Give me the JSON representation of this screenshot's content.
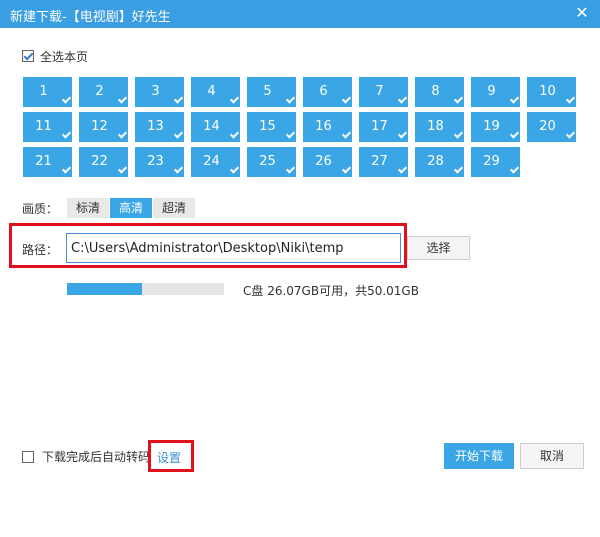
{
  "window": {
    "title": "新建下载-【电视剧】好先生",
    "close_label": "✕"
  },
  "select_all": {
    "label": "全选本页",
    "checked": true
  },
  "episodes": [
    "1",
    "2",
    "3",
    "4",
    "5",
    "6",
    "7",
    "8",
    "9",
    "10",
    "11",
    "12",
    "13",
    "14",
    "15",
    "16",
    "17",
    "18",
    "19",
    "20",
    "21",
    "22",
    "23",
    "24",
    "25",
    "26",
    "27",
    "28",
    "29"
  ],
  "quality": {
    "label": "画质：",
    "options": [
      "标清",
      "高清",
      "超清"
    ],
    "selected": "高清"
  },
  "path": {
    "label": "路径：",
    "value": "C:\\Users\\Administrator\\Desktop\\Niki\\temp",
    "choose_label": "选择"
  },
  "disk": {
    "info": "C盘 26.07GB可用，共50.01GB",
    "used_fraction": 0.48
  },
  "auto_convert": {
    "label": "下载完成后自动转码",
    "checked": false
  },
  "settings_label": "设置",
  "buttons": {
    "start": "开始下载",
    "cancel": "取消"
  },
  "colors": {
    "accent": "#3aa6e6",
    "titlebar": "#3a9ee3",
    "highlight_outline": "#e0101c"
  }
}
